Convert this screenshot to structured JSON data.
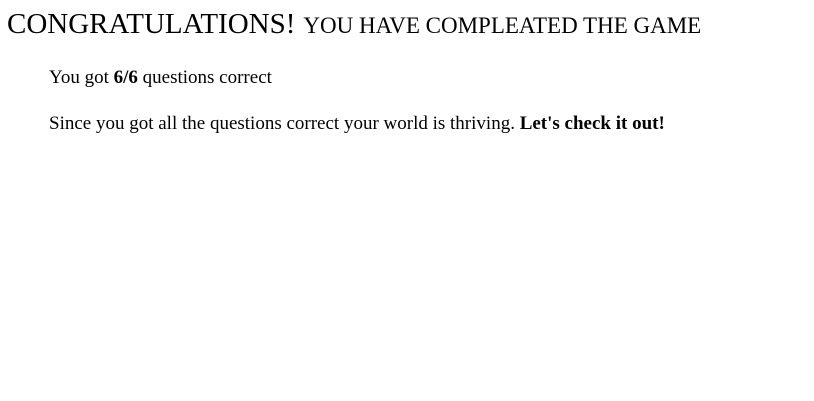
{
  "title": {
    "main": "CONGRATULATIONS!",
    "rest": "YOU HAVE COMPLEATED THE GAME"
  },
  "score": {
    "prefix": "You got",
    "value": "6/6",
    "suffix": "questions correct"
  },
  "result": {
    "text": "Since you got all the questions correct your world is thriving.",
    "link": "Let's check it out!"
  }
}
